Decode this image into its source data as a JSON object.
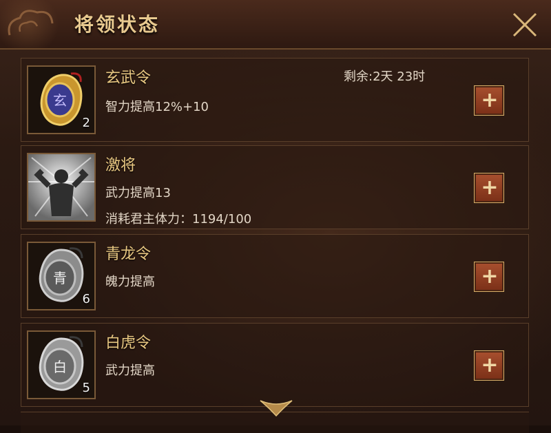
{
  "dialog": {
    "title": "将领状态"
  },
  "items": [
    {
      "name": "玄武令",
      "icon": "xuanwu-token-icon",
      "count": "2",
      "time_left": "剩余:2天 23时",
      "effect": "智力提高12%+10",
      "plus_label": "+"
    },
    {
      "name": "激将",
      "icon": "rally-warrior-icon",
      "effect": "武力提高13",
      "cost": "消耗君主体力：1194/100",
      "plus_label": "+"
    },
    {
      "name": "青龙令",
      "icon": "qinglong-token-icon",
      "glyph": "青",
      "count": "6",
      "effect": "魄力提高",
      "plus_label": "+"
    },
    {
      "name": "白虎令",
      "icon": "baihu-token-icon",
      "glyph": "白",
      "count": "5",
      "effect": "武力提高",
      "plus_label": "+"
    }
  ],
  "colors": {
    "title": "#e8c98f",
    "item_name": "#e9c882",
    "text": "#e2d6c6",
    "button": "#a8502f"
  }
}
